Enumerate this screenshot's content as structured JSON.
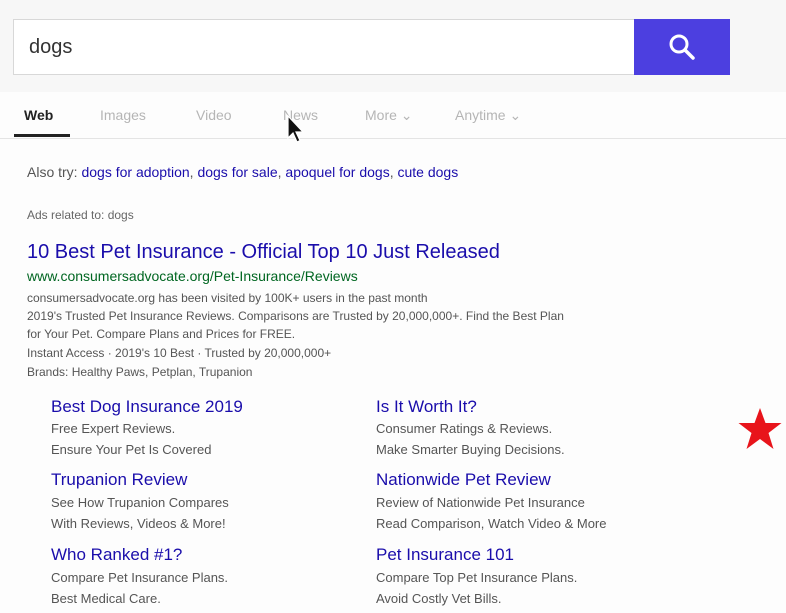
{
  "search": {
    "query": "dogs"
  },
  "tabs": [
    {
      "label": "Web"
    },
    {
      "label": "Images"
    },
    {
      "label": "Video"
    },
    {
      "label": "News"
    },
    {
      "label": "More ⌄"
    },
    {
      "label": "Anytime ⌄"
    }
  ],
  "also_try": {
    "label": "Also try:",
    "links": [
      "dogs for adoption",
      "dogs for sale",
      "apoquel for dogs",
      "cute dogs"
    ]
  },
  "ads_label": "Ads related to: dogs",
  "ad": {
    "title": "10 Best Pet Insurance - Official Top 10 Just Released",
    "url": "www.consumersadvocate.org/Pet-Insurance/Reviews",
    "lines": [
      "consumersadvocate.org has been visited by 100K+ users in the past month",
      "2019's Trusted Pet Insurance Reviews. Comparisons are Trusted by 20,000,000+. Find the Best Plan",
      "for Your Pet. Compare Plans and Prices for FREE.",
      "Instant Access · 2019's 10 Best · Trusted by 20,000,000+",
      "Brands: Healthy Paws, Petplan, Trupanion"
    ]
  },
  "sitelinks": [
    {
      "title": "Best Dog Insurance 2019",
      "desc1": "Free Expert Reviews.",
      "desc2": "Ensure Your Pet Is Covered"
    },
    {
      "title": "Is It Worth It?",
      "desc1": "Consumer Ratings & Reviews.",
      "desc2": "Make Smarter Buying Decisions."
    },
    {
      "title": "Trupanion Review",
      "desc1": "See How Trupanion Compares",
      "desc2": "With Reviews, Videos & More!"
    },
    {
      "title": "Nationwide Pet Review",
      "desc1": "Review of Nationwide Pet Insurance",
      "desc2": "Read Comparison, Watch Video & More"
    },
    {
      "title": "Who Ranked #1?",
      "desc1": "Compare Pet Insurance Plans.",
      "desc2": "Best Medical Care."
    },
    {
      "title": "Pet Insurance 101",
      "desc1": "Compare Top Pet Insurance Plans.",
      "desc2": "Avoid Costly Vet Bills."
    }
  ],
  "colors": {
    "search_button": "#4c3fe0",
    "link": "#1a0dab",
    "url": "#006621",
    "star": "#e8141b"
  },
  "icons": {
    "search": "magnifier-icon",
    "cursor": "mouse-pointer-icon",
    "marker": "star-icon"
  }
}
